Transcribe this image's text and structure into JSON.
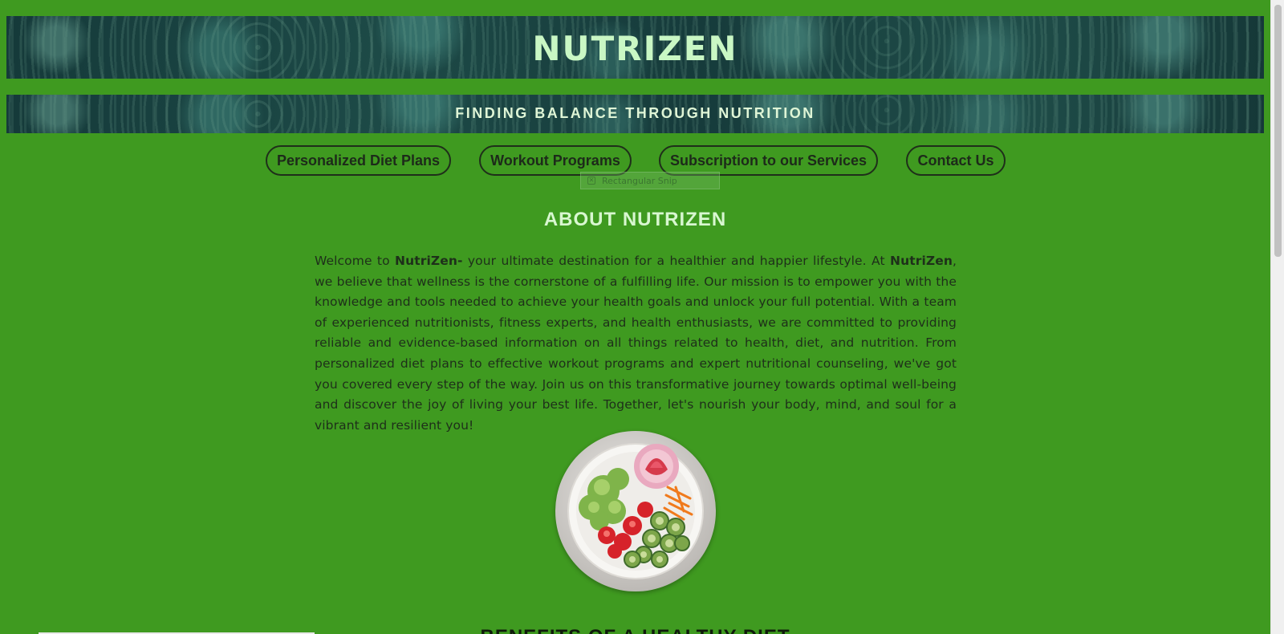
{
  "header": {
    "site_title": "NUTRIZEN",
    "tagline": "FINDING BALANCE THROUGH NUTRITION"
  },
  "nav": {
    "items": [
      {
        "label": "Personalized Diet Plans"
      },
      {
        "label": "Workout Programs"
      },
      {
        "label": "Subscription to our Services"
      },
      {
        "label": "Contact Us"
      }
    ]
  },
  "overlay": {
    "snip_tooltip": "Rectangular Snip"
  },
  "about": {
    "heading": "ABOUT NUTRIZEN",
    "p1": "Welcome to ",
    "brand1": "NutriZen-",
    "p2": " your ultimate destination for a healthier and happier lifestyle. At ",
    "brand2": "NutriZen",
    "p3": ", we believe that wellness is the cornerstone of a fulfilling life. Our mission is to empower you with the knowledge and tools needed to achieve your health goals and unlock your full potential. With a team of experienced nutritionists, fitness experts, and health enthusiasts, we are committed to providing reliable and evidence-based information on all things related to health, diet, and nutrition. From personalized diet plans to effective workout programs and expert nutritional counseling, we've got you covered every step of the way. Join us on this transformative journey towards optimal well-being and discover the joy of living your best life. Together, let's nourish your body, mind, and soul for a vibrant and resilient you!"
  },
  "next_section": {
    "heading": "BENEFITS OF A HEALTHY DIET"
  },
  "colors": {
    "page_bg": "#3f9a20",
    "title_text": "#c9f7c4",
    "heading_text": "#d8f7d0",
    "body_text": "#1e2f1a"
  }
}
